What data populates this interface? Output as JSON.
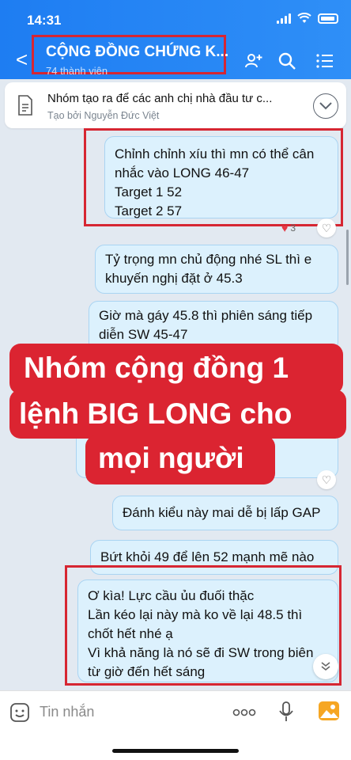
{
  "status": {
    "time": "14:31"
  },
  "header": {
    "title": "CỘNG ĐỒNG CHỨNG K...",
    "members": "74 thành viên"
  },
  "pinned": {
    "text": "Nhóm tạo ra để các anh chị nhà đầu tư c...",
    "sub": "Tạo bởi Nguyễn Đức Việt"
  },
  "messages": [
    {
      "lines": [
        "Chỉnh chỉnh xíu thì mn có thể cân",
        "nhắc vào LONG 46-47",
        "Target 1 52",
        "Target 2 57"
      ],
      "reaction_count": "3"
    },
    {
      "lines": [
        "Tỷ trọng mn chủ động nhé SL thì e",
        "khuyến nghị đặt ở 45.3"
      ]
    },
    {
      "lines": [
        "Giờ mà gáy 45.8 thì phiên sáng tiếp",
        "diễn SW 45-47"
      ]
    },
    {
      "lines": [
        "Đánh kiểu này mai dễ bị lấp GAP"
      ]
    },
    {
      "lines": [
        "Bứt khỏi 49 để lên 52 mạnh mẽ nào"
      ]
    },
    {
      "lines": [
        "Ơ kìa! Lực cầu ủu đuối thặc",
        "Lần kéo lại này mà ko về lại 48.5 thì",
        "chốt hết nhé ạ",
        "Vì khả năng là nó sẽ đi SW trong biên",
        "từ giờ đến hết sáng"
      ]
    }
  ],
  "banner": {
    "lines": [
      "Nhóm cộng đồng 1",
      "lệnh BIG LONG cho",
      "mọi người"
    ]
  },
  "composer": {
    "placeholder": "Tin nhắn"
  },
  "colors": {
    "accent": "#1e7df2",
    "highlight": "#d62632",
    "bubble": "#dcf1fd"
  }
}
